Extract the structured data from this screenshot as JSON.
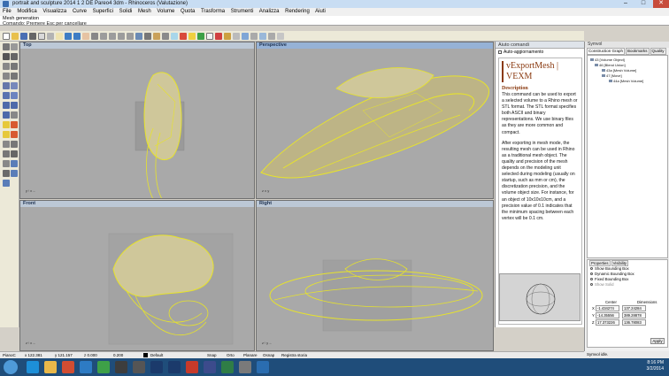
{
  "window": {
    "title": "portrait and sculpture 2014 1 2 DE Pareo4 3dm - Rhinoceros (Valutazione)",
    "minimize": "–",
    "maximize": "□",
    "close": "✕"
  },
  "menu": [
    "File",
    "Modifica",
    "Visualizza",
    "Curve",
    "Superfici",
    "Solidi",
    "Mesh",
    "Volume",
    "Quota",
    "Trasforma",
    "Strumenti",
    "Analizza",
    "Rendering",
    "Aiuti"
  ],
  "command": {
    "line1": "Mesh generation",
    "line2": "Comando: Premere Esc per cancellare"
  },
  "viewports": {
    "top": "Top",
    "perspective": "Perspective",
    "front": "Front",
    "right": "Right"
  },
  "help": {
    "tab": "Aiuto comandi",
    "auto_update": "Auto-aggiornamento",
    "title": "vExportMesh | VEXM",
    "section": "Description",
    "p1": "This command can be used to export a selected volume to a Rhino mesh or STL format. The STL format specifies both ASCII and binary representations. We use binary files as they are more common and compact.",
    "p2": "After exporting in mesh mode, the resulting mesh can be used in Rhino as a traditional mesh object. The quality and precision of the mesh depends on the modeling unit selected during modeling (usually on startup, such as mm or cm), the discretization precision, and the volume object size. For instance, for an object of 10x10x10cm, and a precision value of 0.1 indicates that the minimum spacing between each vertex will be 0.1 cm."
  },
  "panel": {
    "header": "Symvol",
    "tabs": [
      "Construction Graph",
      "Bookmarks",
      "Quality"
    ],
    "graph": [
      {
        "label": "43 [Volume Object]",
        "indent": 0
      },
      {
        "label": "46 [Blend Union]",
        "indent": 1
      },
      {
        "label": "43a [Mesh Volume]",
        "indent": 2
      },
      {
        "label": "47 [Move]",
        "indent": 2
      },
      {
        "label": "44a [Mesh Volume]",
        "indent": 3
      }
    ],
    "props_tabs": [
      "Properties",
      "Visibility"
    ],
    "opt1": "Show Bounding Box",
    "opt2": "Dynamic Bounding Box",
    "opt3": "Fixed Bounding Box",
    "opt4": "Show Solid",
    "center_label": "Center",
    "dim_label": "Dimensions",
    "rows": [
      {
        "axis": "X",
        "center": "-1.434274",
        "dim": "137.24284"
      },
      {
        "axis": "Y",
        "center": "-14.35556",
        "dim": "389.28878"
      },
      {
        "axis": "Z",
        "center": "17.373226",
        "dim": "136.78083"
      }
    ],
    "apply": "Apply",
    "status": "Symvol idle."
  },
  "status": {
    "plane": "PianoC",
    "x": "x 122.381",
    "y": "y 121.157",
    "z": "z 0.000",
    "val": "0.200",
    "layer": "Default",
    "snap": "Snap",
    "orto": "Orto",
    "planare": "Planare",
    "osnap": "Osnap",
    "registra": "Registra storia"
  },
  "clock": {
    "time": "8:16 PM",
    "date": "3/2/2014"
  },
  "colors": {
    "wire": "#e7e32b",
    "shape": "#c9c090",
    "taskbar": "#1f4d7a"
  }
}
